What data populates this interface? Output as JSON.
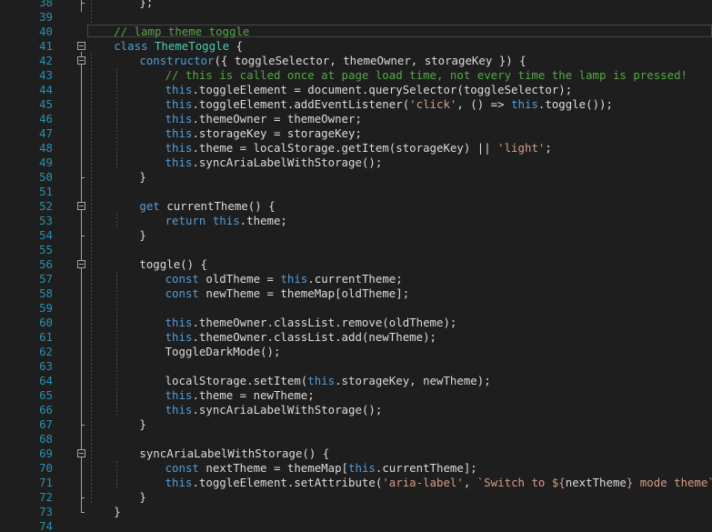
{
  "editor": {
    "colors": {
      "background": "#1e1e1e",
      "line_number": "#2b91af",
      "keyword": "#569cd6",
      "class_name": "#4ec9b0",
      "string": "#d69d85",
      "comment": "#57a64a",
      "plain": "#dcdcdc"
    },
    "lines": [
      {
        "n": "38",
        "indent": 2,
        "tokens": [
          {
            "t": "pl",
            "v": "};"
          }
        ]
      },
      {
        "n": "39",
        "indent": 0,
        "tokens": []
      },
      {
        "n": "40",
        "indent": 1,
        "tokens": [
          {
            "t": "cm",
            "v": "// lamp theme toggle"
          }
        ]
      },
      {
        "n": "41",
        "indent": 1,
        "fold": true,
        "tokens": [
          {
            "t": "kw",
            "v": "class"
          },
          {
            "t": "pl",
            "v": " "
          },
          {
            "t": "cls",
            "v": "ThemeToggle"
          },
          {
            "t": "pl",
            "v": " {"
          }
        ]
      },
      {
        "n": "42",
        "indent": 2,
        "fold": true,
        "tokens": [
          {
            "t": "kw",
            "v": "constructor"
          },
          {
            "t": "pl",
            "v": "({ toggleSelector, themeOwner, storageKey }) {"
          }
        ]
      },
      {
        "n": "43",
        "indent": 3,
        "tokens": [
          {
            "t": "cm",
            "v": "// this is called once at page load time, not every time the lamp is pressed!"
          }
        ]
      },
      {
        "n": "44",
        "indent": 3,
        "tokens": [
          {
            "t": "kw",
            "v": "this"
          },
          {
            "t": "pl",
            "v": ".toggleElement = document.querySelector(toggleSelector);"
          }
        ]
      },
      {
        "n": "45",
        "indent": 3,
        "tokens": [
          {
            "t": "kw",
            "v": "this"
          },
          {
            "t": "pl",
            "v": ".toggleElement.addEventListener("
          },
          {
            "t": "str",
            "v": "'click'"
          },
          {
            "t": "pl",
            "v": ", () => "
          },
          {
            "t": "kw",
            "v": "this"
          },
          {
            "t": "pl",
            "v": ".toggle());"
          }
        ]
      },
      {
        "n": "46",
        "indent": 3,
        "tokens": [
          {
            "t": "kw",
            "v": "this"
          },
          {
            "t": "pl",
            "v": ".themeOwner = themeOwner;"
          }
        ]
      },
      {
        "n": "47",
        "indent": 3,
        "tokens": [
          {
            "t": "kw",
            "v": "this"
          },
          {
            "t": "pl",
            "v": ".storageKey = storageKey;"
          }
        ]
      },
      {
        "n": "48",
        "indent": 3,
        "tokens": [
          {
            "t": "kw",
            "v": "this"
          },
          {
            "t": "pl",
            "v": ".theme = localStorage.getItem(storageKey) || "
          },
          {
            "t": "str",
            "v": "'light'"
          },
          {
            "t": "pl",
            "v": ";"
          }
        ]
      },
      {
        "n": "49",
        "indent": 3,
        "tokens": [
          {
            "t": "kw",
            "v": "this"
          },
          {
            "t": "pl",
            "v": ".syncAriaLabelWithStorage();"
          }
        ]
      },
      {
        "n": "50",
        "indent": 2,
        "tokens": [
          {
            "t": "pl",
            "v": "}"
          }
        ]
      },
      {
        "n": "51",
        "indent": 0,
        "tokens": []
      },
      {
        "n": "52",
        "indent": 2,
        "fold": true,
        "tokens": [
          {
            "t": "kw",
            "v": "get"
          },
          {
            "t": "pl",
            "v": " currentTheme() {"
          }
        ]
      },
      {
        "n": "53",
        "indent": 3,
        "tokens": [
          {
            "t": "kw",
            "v": "return"
          },
          {
            "t": "pl",
            "v": " "
          },
          {
            "t": "kw",
            "v": "this"
          },
          {
            "t": "pl",
            "v": ".theme;"
          }
        ]
      },
      {
        "n": "54",
        "indent": 2,
        "tokens": [
          {
            "t": "pl",
            "v": "}"
          }
        ]
      },
      {
        "n": "55",
        "indent": 0,
        "tokens": []
      },
      {
        "n": "56",
        "indent": 2,
        "fold": true,
        "tokens": [
          {
            "t": "pl",
            "v": "toggle() {"
          }
        ]
      },
      {
        "n": "57",
        "indent": 3,
        "tokens": [
          {
            "t": "kw",
            "v": "const"
          },
          {
            "t": "pl",
            "v": " oldTheme = "
          },
          {
            "t": "kw",
            "v": "this"
          },
          {
            "t": "pl",
            "v": ".currentTheme;"
          }
        ]
      },
      {
        "n": "58",
        "indent": 3,
        "tokens": [
          {
            "t": "kw",
            "v": "const"
          },
          {
            "t": "pl",
            "v": " newTheme = themeMap[oldTheme];"
          }
        ]
      },
      {
        "n": "59",
        "indent": 0,
        "tokens": []
      },
      {
        "n": "60",
        "indent": 3,
        "tokens": [
          {
            "t": "kw",
            "v": "this"
          },
          {
            "t": "pl",
            "v": ".themeOwner.classList.remove(oldTheme);"
          }
        ]
      },
      {
        "n": "61",
        "indent": 3,
        "tokens": [
          {
            "t": "kw",
            "v": "this"
          },
          {
            "t": "pl",
            "v": ".themeOwner.classList.add(newTheme);"
          }
        ]
      },
      {
        "n": "62",
        "indent": 3,
        "tokens": [
          {
            "t": "pl",
            "v": "ToggleDarkMode();"
          }
        ]
      },
      {
        "n": "63",
        "indent": 0,
        "tokens": []
      },
      {
        "n": "64",
        "indent": 3,
        "tokens": [
          {
            "t": "pl",
            "v": "localStorage.setItem("
          },
          {
            "t": "kw",
            "v": "this"
          },
          {
            "t": "pl",
            "v": ".storageKey, newTheme);"
          }
        ]
      },
      {
        "n": "65",
        "indent": 3,
        "tokens": [
          {
            "t": "kw",
            "v": "this"
          },
          {
            "t": "pl",
            "v": ".theme = newTheme;"
          }
        ]
      },
      {
        "n": "66",
        "indent": 3,
        "tokens": [
          {
            "t": "kw",
            "v": "this"
          },
          {
            "t": "pl",
            "v": ".syncAriaLabelWithStorage();"
          }
        ]
      },
      {
        "n": "67",
        "indent": 2,
        "tokens": [
          {
            "t": "pl",
            "v": "}"
          }
        ]
      },
      {
        "n": "68",
        "indent": 0,
        "tokens": []
      },
      {
        "n": "69",
        "indent": 2,
        "fold": true,
        "tokens": [
          {
            "t": "pl",
            "v": "syncAriaLabelWithStorage() {"
          }
        ]
      },
      {
        "n": "70",
        "indent": 3,
        "tokens": [
          {
            "t": "kw",
            "v": "const"
          },
          {
            "t": "pl",
            "v": " nextTheme = themeMap["
          },
          {
            "t": "kw",
            "v": "this"
          },
          {
            "t": "pl",
            "v": ".currentTheme];"
          }
        ]
      },
      {
        "n": "71",
        "indent": 3,
        "tokens": [
          {
            "t": "kw",
            "v": "this"
          },
          {
            "t": "pl",
            "v": ".toggleElement.setAttribute("
          },
          {
            "t": "str",
            "v": "'aria-label'"
          },
          {
            "t": "pl",
            "v": ", "
          },
          {
            "t": "str",
            "v": "`Switch to ${"
          },
          {
            "t": "pl",
            "v": "nextTheme"
          },
          {
            "t": "str",
            "v": "} mode theme`"
          },
          {
            "t": "pl",
            "v": ");"
          }
        ]
      },
      {
        "n": "72",
        "indent": 2,
        "tokens": [
          {
            "t": "pl",
            "v": "}"
          }
        ]
      },
      {
        "n": "73",
        "indent": 1,
        "tokens": [
          {
            "t": "pl",
            "v": "}"
          }
        ]
      },
      {
        "n": "74",
        "indent": 0,
        "tokens": []
      }
    ]
  }
}
